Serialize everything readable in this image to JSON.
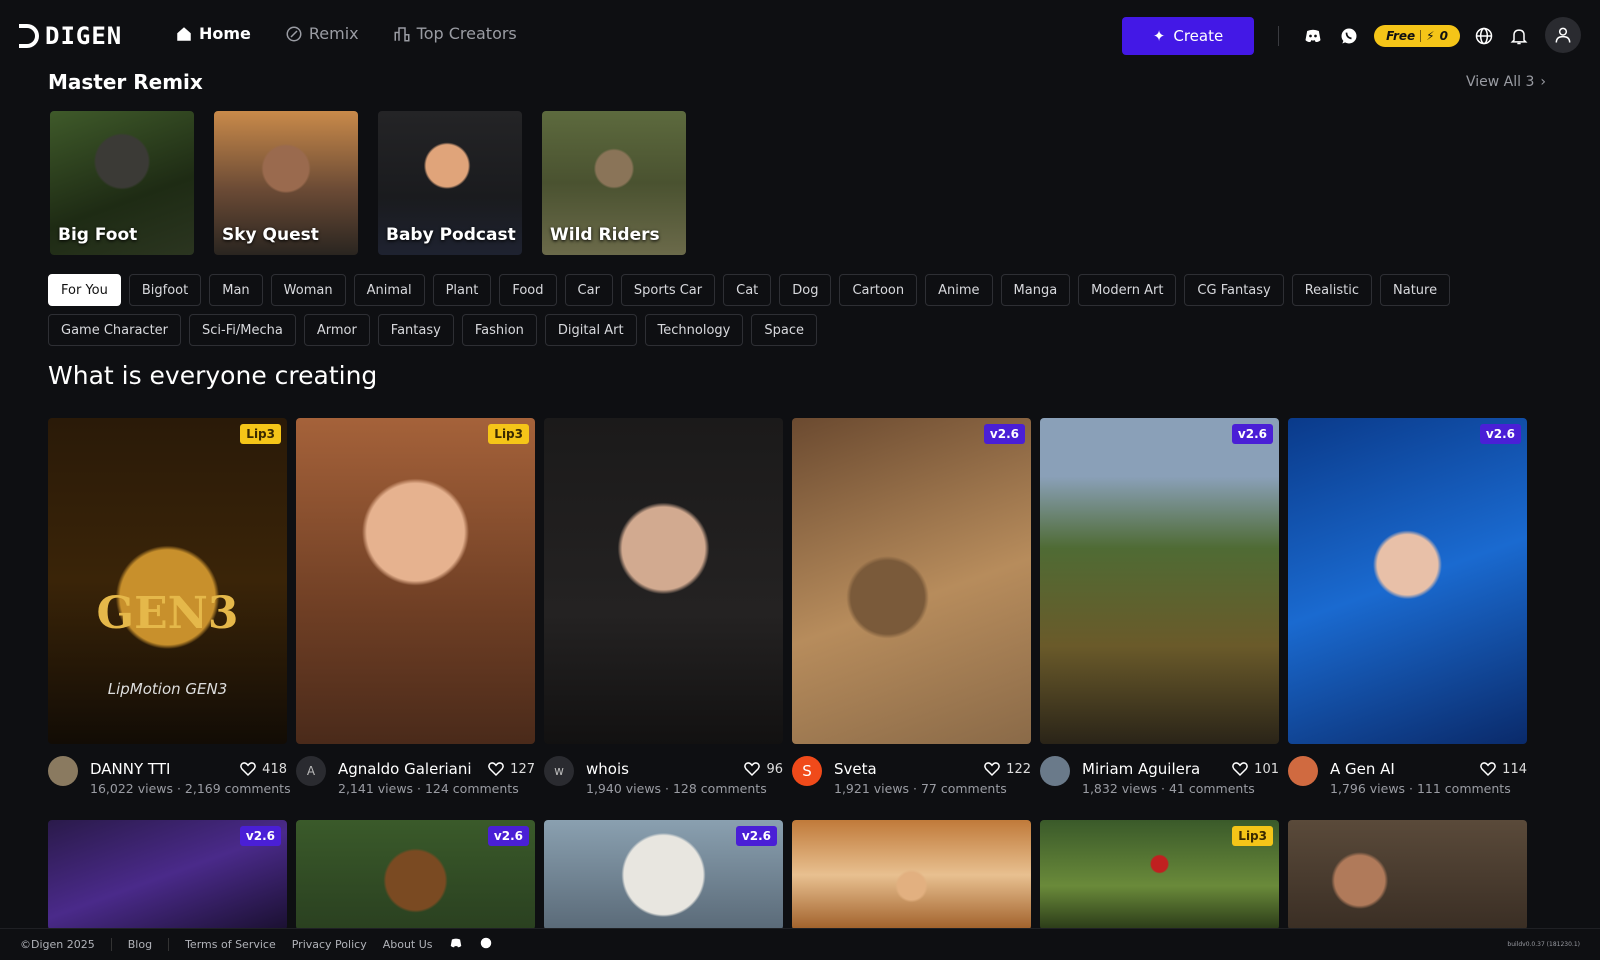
{
  "brand": {
    "name": "DIGEN"
  },
  "nav": [
    {
      "label": "Home",
      "icon": "home-icon",
      "active": true
    },
    {
      "label": "Remix",
      "icon": "remix-icon",
      "active": false
    },
    {
      "label": "Top Creators",
      "icon": "top-creators-icon",
      "active": false
    }
  ],
  "header": {
    "create_label": "Create",
    "free_label": "Free",
    "credits": "0",
    "accent": "#4318e6",
    "free_color": "#f5c518"
  },
  "master_remix": {
    "title": "Master Remix",
    "view_all": "View All 3",
    "items": [
      {
        "label": "Big Foot"
      },
      {
        "label": "Sky Quest"
      },
      {
        "label": "Baby Podcast"
      },
      {
        "label": "Wild Riders"
      }
    ]
  },
  "tags": [
    "For You",
    "Bigfoot",
    "Man",
    "Woman",
    "Animal",
    "Plant",
    "Food",
    "Car",
    "Sports Car",
    "Cat",
    "Dog",
    "Cartoon",
    "Anime",
    "Manga",
    "Modern Art",
    "CG Fantasy",
    "Realistic",
    "Nature",
    "Game Character",
    "Sci-Fi/Mecha",
    "Armor",
    "Fantasy",
    "Fashion",
    "Digital Art",
    "Technology",
    "Space"
  ],
  "feed": {
    "title": "What is everyone creating",
    "cards": [
      {
        "badge": "Lip3",
        "user": "DANNY TTI",
        "avatar": "",
        "likes": "418",
        "stats": "16,022 views · 2,169 comments",
        "thumb_text": "GEN3",
        "thumb_sub": "LipMotion GEN3"
      },
      {
        "badge": "Lip3",
        "user": "Agnaldo Galeriani",
        "avatar": "A",
        "likes": "127",
        "stats": "2,141 views · 124 comments"
      },
      {
        "badge": "",
        "user": "whois",
        "avatar": "w",
        "likes": "96",
        "stats": "1,940 views · 128 comments"
      },
      {
        "badge": "v2.6",
        "user": "Sveta",
        "avatar": "S",
        "likes": "122",
        "stats": "1,921 views · 77 comments"
      },
      {
        "badge": "v2.6",
        "user": "Miriam Aguilera",
        "avatar": "",
        "likes": "101",
        "stats": "1,832 views · 41 comments"
      },
      {
        "badge": "v2.6",
        "user": "A Gen AI",
        "avatar": "",
        "likes": "114",
        "stats": "1,796 views · 111 comments"
      },
      {
        "badge": "v2.6"
      },
      {
        "badge": "v2.6"
      },
      {
        "badge": "v2.6"
      },
      {
        "badge": ""
      },
      {
        "badge": "Lip3"
      },
      {
        "badge": ""
      }
    ]
  },
  "footer": {
    "copyright": "©Digen 2025",
    "links": [
      "Blog",
      "Terms of Service",
      "Privacy Policy",
      "About Us"
    ],
    "build": "buildv0.0.37 (181230.1)"
  }
}
